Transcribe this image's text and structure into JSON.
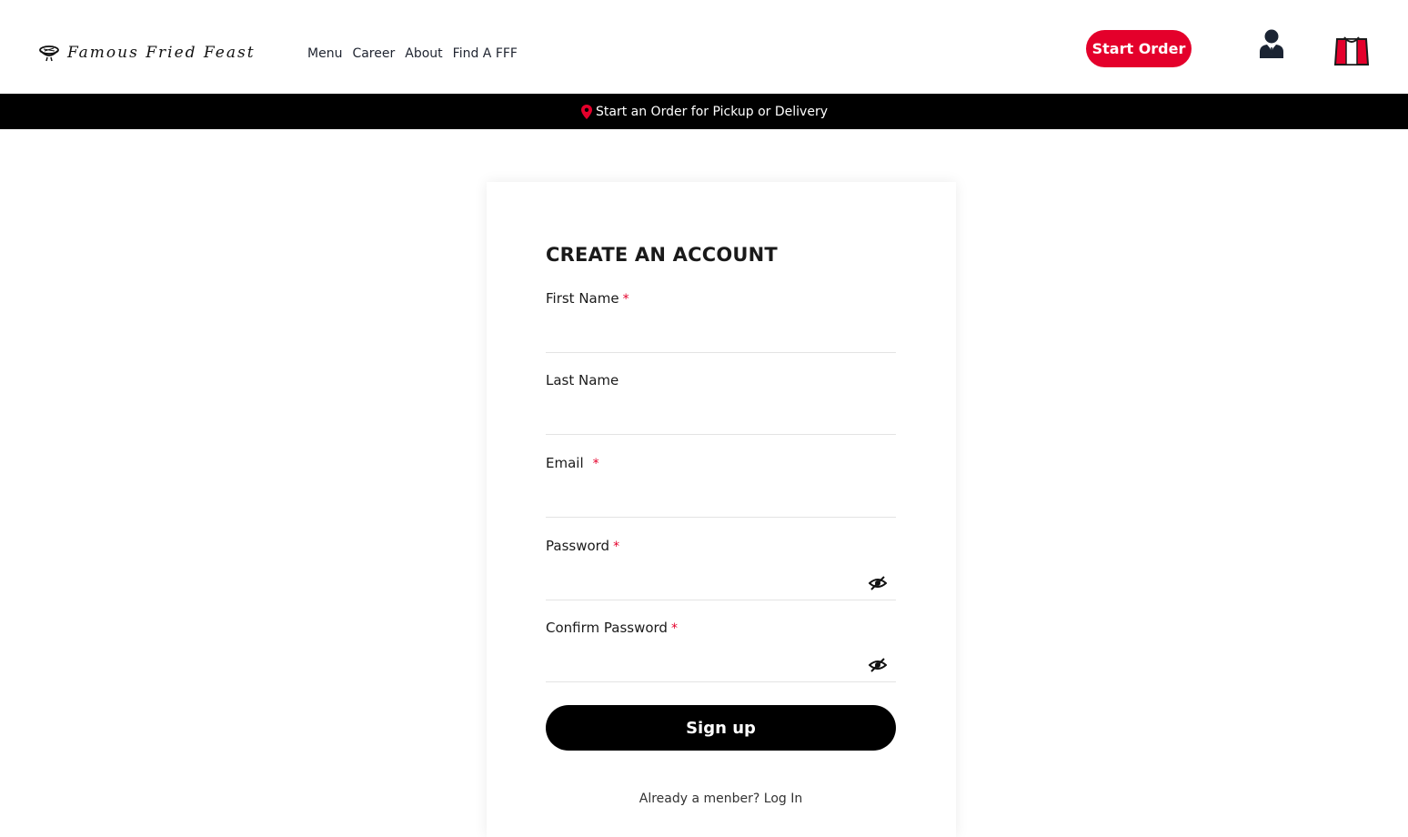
{
  "header": {
    "logo_text": "Famous Fried Feast",
    "nav": [
      "Menu",
      "Career",
      "About",
      "Find A FFF"
    ],
    "start_order_label": "Start Order",
    "accent_color": "#e4002b"
  },
  "banner": {
    "text": "Start an Order for Pickup or Delivery",
    "icon": "map-pin-icon"
  },
  "form": {
    "title": "CREATE AN ACCOUNT",
    "fields": [
      {
        "label": "First Name",
        "required": "*",
        "value": ""
      },
      {
        "label": "Last Name",
        "required": "",
        "value": ""
      },
      {
        "label": "Email",
        "required": "*",
        "value": ""
      },
      {
        "label": "Password",
        "required": "*",
        "value": "",
        "icon": "eye-slash-icon"
      },
      {
        "label": "Confirm Password",
        "required": "*",
        "value": "",
        "icon": "eye-slash-icon"
      }
    ],
    "submit_label": "Sign up",
    "login_prompt": "Already a menber?",
    "login_link": "Log In"
  }
}
